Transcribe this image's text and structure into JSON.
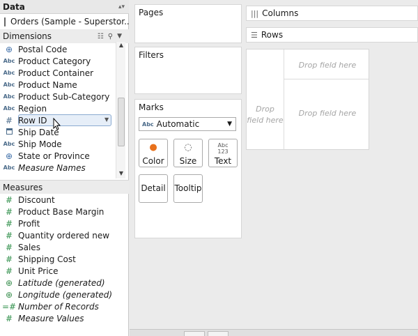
{
  "data_pane": {
    "title": "Data",
    "datasource": "Orders (Sample - Superstor..."
  },
  "dimensions": {
    "title": "Dimensions",
    "items": [
      {
        "label": "Postal Code",
        "icon": "globe-icon"
      },
      {
        "label": "Product Category",
        "icon": "abc-icon"
      },
      {
        "label": "Product Container",
        "icon": "abc-icon"
      },
      {
        "label": "Product Name",
        "icon": "abc-icon"
      },
      {
        "label": "Product Sub-Category",
        "icon": "abc-icon"
      },
      {
        "label": "Region",
        "icon": "abc-icon"
      },
      {
        "label": "Row ID",
        "icon": "hash-icon"
      },
      {
        "label": "Ship Date",
        "icon": "calendar-icon"
      },
      {
        "label": "Ship Mode",
        "icon": "abc-icon"
      },
      {
        "label": "State or Province",
        "icon": "globe-icon"
      },
      {
        "label": "Measure Names",
        "icon": "abc-icon"
      }
    ]
  },
  "measures": {
    "title": "Measures",
    "items": [
      {
        "label": "Discount",
        "icon": "hash-icon"
      },
      {
        "label": "Product Base Margin",
        "icon": "hash-icon"
      },
      {
        "label": "Profit",
        "icon": "hash-icon"
      },
      {
        "label": "Quantity ordered new",
        "icon": "hash-icon"
      },
      {
        "label": "Sales",
        "icon": "hash-icon"
      },
      {
        "label": "Shipping Cost",
        "icon": "hash-icon"
      },
      {
        "label": "Unit Price",
        "icon": "hash-icon"
      },
      {
        "label": "Latitude (generated)",
        "icon": "globe-icon"
      },
      {
        "label": "Longitude (generated)",
        "icon": "globe-icon"
      },
      {
        "label": "Number of Records",
        "icon": "hash-icon"
      },
      {
        "label": "Measure Values",
        "icon": "hash-icon"
      }
    ]
  },
  "cards": {
    "pages": "Pages",
    "filters": "Filters",
    "marks": "Marks",
    "mark_type_prefix": "Abc",
    "mark_type": "Automatic",
    "color": "Color",
    "size": "Size",
    "text": "Text",
    "text_glyph_top": "Abc",
    "text_glyph_bottom": "123",
    "detail": "Detail",
    "tooltip": "Tooltip"
  },
  "shelves": {
    "columns": "Columns",
    "rows": "Rows"
  },
  "view": {
    "drop_top": "Drop field here",
    "drop_left_1": "Drop",
    "drop_left_2": "field here",
    "drop_main": "Drop field here"
  },
  "colors": {
    "accent": "#e8711c",
    "measure_icon": "#2f8f4a",
    "dimension_icon": "#4b6b8a"
  }
}
